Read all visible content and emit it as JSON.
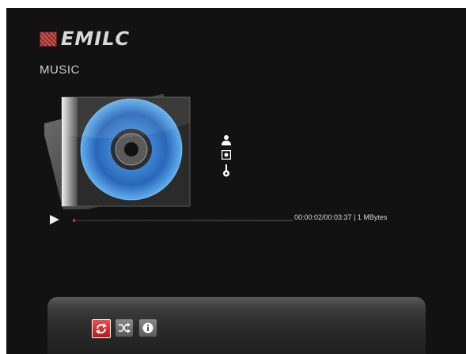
{
  "brand": {
    "logo_text": "EMILC",
    "logo_icon": "brand-mosaic-icon"
  },
  "page": {
    "title": "MUSIC"
  },
  "now_playing": {
    "album_art": "cd-case-placeholder",
    "meta_icons": [
      "artist-icon",
      "album-icon",
      "genre-icon"
    ],
    "progress": 0.01,
    "time_text": "00:00:02/00:03:37 | 1 MBytes",
    "state_icon": "play-icon"
  },
  "controls": [
    {
      "name": "repeat",
      "icon": "repeat-icon",
      "active": true
    },
    {
      "name": "shuffle",
      "icon": "shuffle-icon",
      "active": false
    },
    {
      "name": "info",
      "icon": "info-icon",
      "active": false
    }
  ],
  "colors": {
    "accent": "#e02020",
    "background": "#121212"
  }
}
